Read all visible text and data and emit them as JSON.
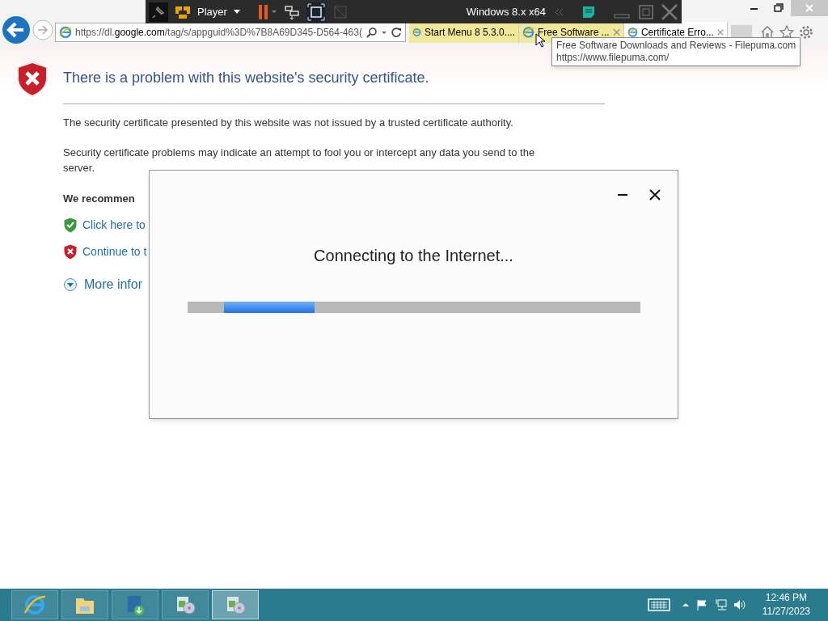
{
  "player_bar": {
    "menu": "Player",
    "vm_name": "Windows 8.x x64"
  },
  "browser": {
    "address": {
      "prefix": "https://dl.",
      "domain": "google.com",
      "rest": "/tag/s/appguid%3D%7B8A69D345-D564-463("
    },
    "tabs": [
      {
        "label": "Start Menu 8 5.3.0....",
        "selected": false,
        "closable": false
      },
      {
        "label": "Free Software ...",
        "selected": false,
        "closable": true
      },
      {
        "label": "Certificate Erro...",
        "selected": true,
        "closable": true
      }
    ],
    "tooltip": {
      "title": "Free Software Downloads and Reviews - Filepuma.com",
      "url": "https://www.filepuma.com/"
    }
  },
  "page": {
    "heading": "There is a problem with this website's security certificate.",
    "paragraphs": [
      "The security certificate presented by this website was not issued by a trusted certificate authority.",
      "Security certificate problems may indicate an attempt to fool you or intercept any data you send to the server."
    ],
    "recommend": "We recommen",
    "links": [
      {
        "kind": "safe",
        "label": "Click here to"
      },
      {
        "kind": "unsafe",
        "label": "Continue to t"
      }
    ],
    "more": "More infor"
  },
  "dialog": {
    "message": "Connecting to the Internet...",
    "progress": {
      "level": 0.2
    }
  },
  "taskbar": {
    "apps": [
      {
        "kind": "ie",
        "active": false
      },
      {
        "kind": "explorer",
        "active": false
      },
      {
        "kind": "iobit",
        "active": false
      },
      {
        "kind": "installer",
        "active": false
      },
      {
        "kind": "installer",
        "active": true
      }
    ],
    "time": "12:46 PM",
    "date": "11/27/2023"
  }
}
